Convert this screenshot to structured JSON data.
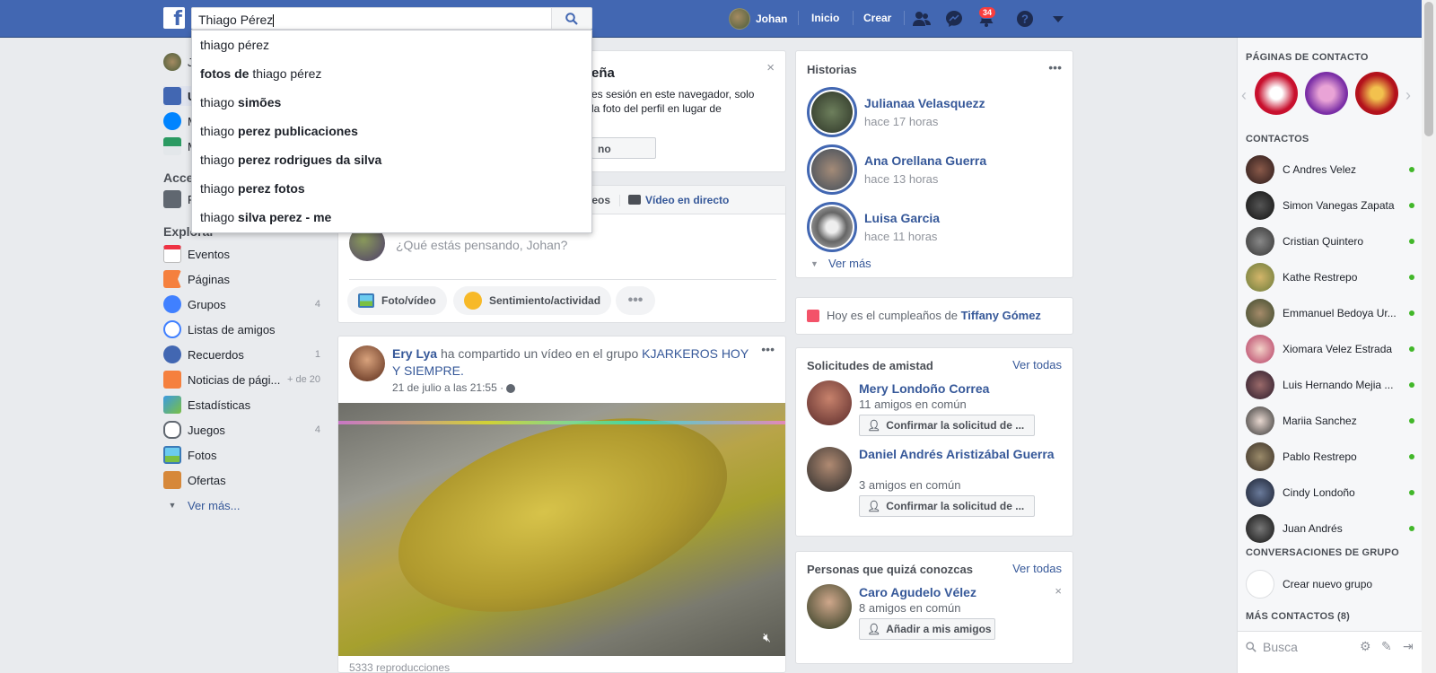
{
  "topbar": {
    "search_value": "Thiago Pérez",
    "user_name": "Johan",
    "home": "Inicio",
    "create": "Crear",
    "notifications_count": "34"
  },
  "search_suggestions": [
    {
      "plain": "thiago pérez",
      "bold": ""
    },
    {
      "bold_prefix": "fotos de",
      "plain": " thiago pérez"
    },
    {
      "plain": "thiago ",
      "bold": "simões"
    },
    {
      "plain": "thiago ",
      "bold": "perez publicaciones"
    },
    {
      "plain": "thiago ",
      "bold": "perez rodrigues da silva"
    },
    {
      "plain": "thiago ",
      "bold": "perez fotos"
    },
    {
      "plain": "thiago ",
      "bold": "silva perez - me"
    }
  ],
  "left_nav": {
    "user_partial": "J",
    "partial_items": [
      "U",
      "M",
      "M"
    ],
    "access_partial": "Acce",
    "access_item": "P",
    "explore_header": "Explorar",
    "items": [
      {
        "label": "Eventos",
        "count": ""
      },
      {
        "label": "Páginas",
        "count": ""
      },
      {
        "label": "Grupos",
        "count": "4"
      },
      {
        "label": "Listas de amigos",
        "count": ""
      },
      {
        "label": "Recuerdos",
        "count": "1"
      },
      {
        "label": "Noticias de pági...",
        "count": "+ de 20"
      },
      {
        "label": "Estadísticas",
        "count": ""
      },
      {
        "label": "Juegos",
        "count": "4"
      },
      {
        "label": "Fotos",
        "count": ""
      },
      {
        "label": "Ofertas",
        "count": ""
      }
    ],
    "see_more": "Ver más..."
  },
  "notice_card": {
    "title_partial": "eña",
    "line1": "es sesión en este navegador, solo",
    "line2": "la foto del perfil en lugar de",
    "button_partial": "no"
  },
  "composer": {
    "tab_videos_partial": "deos",
    "tab_live": "Vídeo en directo",
    "placeholder": "¿Qué estás pensando, Johan?",
    "photo_video": "Foto/vídeo",
    "feeling": "Sentimiento/actividad"
  },
  "post": {
    "author": "Ery Lya",
    "action": " ha compartido un vídeo en el grupo ",
    "group": "KJARKEROS HOY Y SIEMPRE.",
    "date": "21 de julio a las 21:55 · ",
    "views": "5333 reproducciones"
  },
  "stories": {
    "title": "Historias",
    "items": [
      {
        "name": "Julianaa Velasquezz",
        "time": "hace 17 horas"
      },
      {
        "name": "Ana Orellana Guerra",
        "time": "hace 13 horas"
      },
      {
        "name": "Luisa Garcia",
        "time": "hace 11 horas"
      }
    ],
    "see_more": "Ver más"
  },
  "birthday": {
    "text": "Hoy es el cumpleaños de ",
    "name": "Tiffany Gómez"
  },
  "friend_requests": {
    "title": "Solicitudes de amistad",
    "see_all": "Ver todas",
    "items": [
      {
        "name": "Mery Londoño Correa",
        "mutual": "11 amigos en común",
        "button": "Confirmar la solicitud de ..."
      },
      {
        "name": "Daniel Andrés Aristizábal Guerra",
        "mutual": "3 amigos en común",
        "button": "Confirmar la solicitud de ..."
      }
    ]
  },
  "people_you_may_know": {
    "title": "Personas que quizá conozcas",
    "see_all": "Ver todas",
    "name": "Caro Agudelo Vélez",
    "mutual": "8 amigos en común",
    "button": "Añadir a mis amigos"
  },
  "chat": {
    "pages_header": "PÁGINAS DE CONTACTO",
    "contacts_header": "CONTACTOS",
    "contacts": [
      "C Andres Velez",
      "Simon Vanegas Zapata",
      "Cristian Quintero",
      "Kathe Restrepo",
      "Emmanuel Bedoya Ur...",
      "Xiomara Velez Estrada",
      "Luis Hernando Mejia ...",
      "Mariia Sanchez",
      "Pablo Restrepo",
      "Cindy Londoño",
      "Juan Andrés"
    ],
    "group_header": "CONVERSACIONES DE GRUPO",
    "new_group": "Crear nuevo grupo",
    "more_contacts": "MÁS CONTACTOS (8)",
    "search_placeholder": "Busca"
  },
  "colors": {
    "brand": "#4267b2",
    "link": "#365899",
    "online": "#42b72a",
    "badge": "#fa3e3e"
  }
}
